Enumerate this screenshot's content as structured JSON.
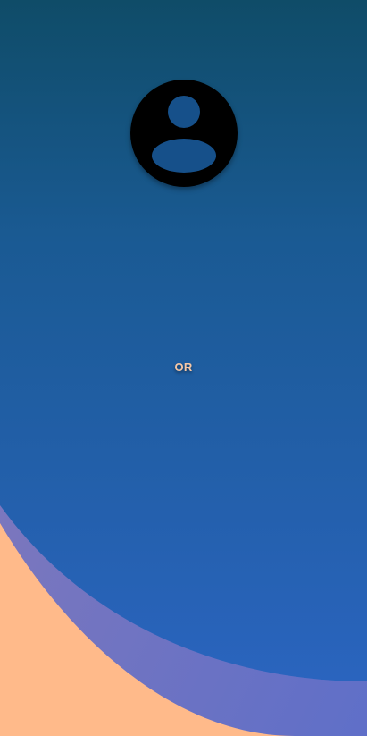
{
  "divider": {
    "or_label": "OR"
  },
  "avatar": {
    "icon": "account-circle-icon"
  },
  "colors": {
    "background_top": "#0F4C68",
    "background_bottom": "#2A64BE",
    "accent_peach": "#FFBA8A",
    "accent_purple": "#6B6FC0",
    "or_text": "#F5C7A6"
  }
}
